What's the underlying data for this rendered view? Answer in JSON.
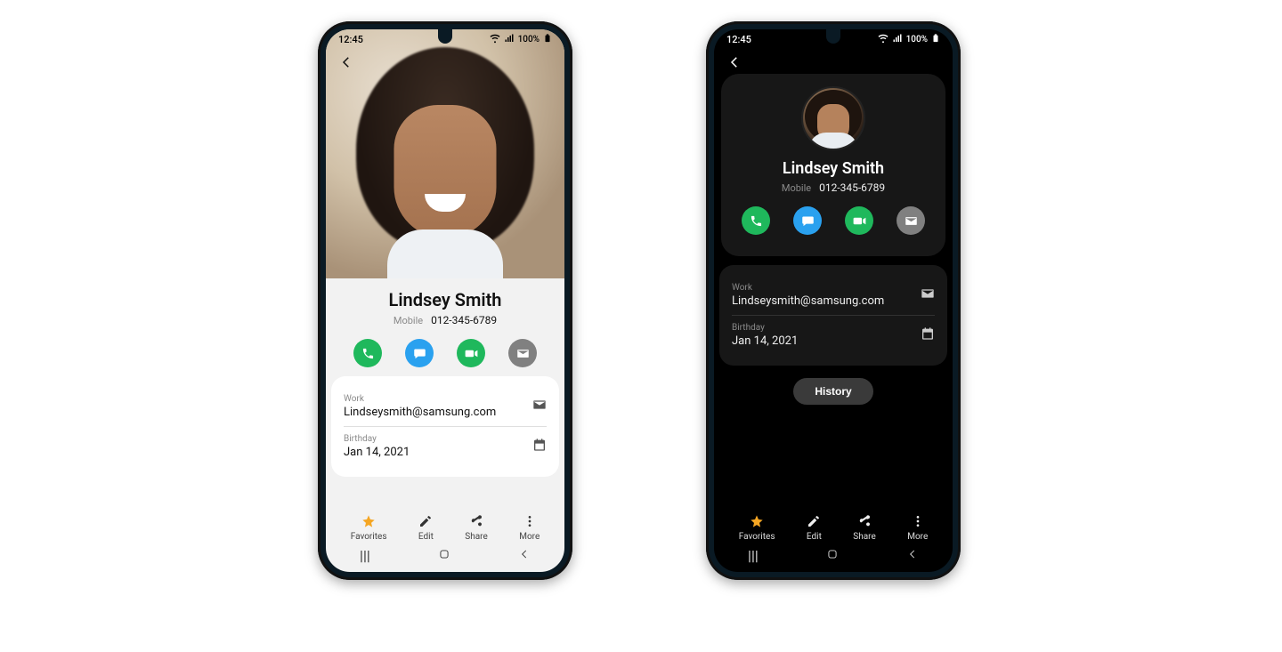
{
  "status": {
    "time": "12:45",
    "battery": "100%"
  },
  "contact": {
    "name": "Lindsey Smith",
    "mobile_label": "Mobile",
    "mobile": "012-345-6789",
    "work_label": "Work",
    "work_email": "Lindseysmith@samsung.com",
    "birthday_label": "Birthday",
    "birthday": "Jan 14, 2021"
  },
  "buttons": {
    "history": "History"
  },
  "bottom": {
    "favorites": "Favorites",
    "edit": "Edit",
    "share": "Share",
    "more": "More"
  }
}
